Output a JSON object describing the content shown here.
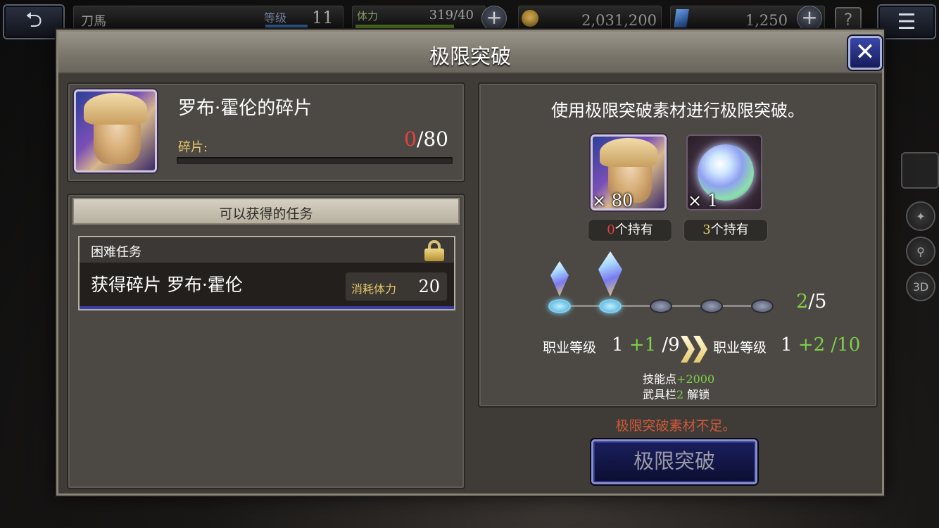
{
  "topbar": {
    "player_name": "刀馬",
    "level_label": "等级",
    "level": "11",
    "stamina_label": "体力",
    "stamina": "319/40",
    "gil": "2,031,200",
    "gems": "1,250",
    "plus": "+",
    "help": "?"
  },
  "side_icons": {
    "icon_3d": "3D"
  },
  "modal": {
    "title": "极限突破",
    "close": "✕"
  },
  "card": {
    "name": "罗布·霍伦的碎片",
    "fragment_label": "碎片:",
    "fragment_owned": "0",
    "fragment_required": "/80"
  },
  "missions": {
    "header": "可以获得的任务",
    "items": [
      {
        "type": "困难任务",
        "name": "获得碎片 罗布·霍伦",
        "stamina_label": "消耗体力",
        "stamina": "20"
      }
    ]
  },
  "limit_break": {
    "description": "使用极限突破素材进行极限突破。",
    "materials": [
      {
        "qty": "× 80",
        "owned_num": "0",
        "owned_label": "个持有"
      },
      {
        "qty": "× 1",
        "owned_num": "3",
        "owned_label": "个持有"
      }
    ],
    "slots_current": "2",
    "slots_total": "/5",
    "job_level_label": "职业等级",
    "job_before": {
      "base": "1",
      "plus": "+1",
      "max": "/9"
    },
    "job_after": {
      "base": "1",
      "plus": "+2",
      "max": "/10"
    },
    "bonus_skill_label": "技能点",
    "bonus_skill_value": "+2000",
    "bonus_weapon_label": "武具栏",
    "bonus_weapon_value": "2",
    "bonus_weapon_suffix": " 解锁"
  },
  "warning": "极限突破素材不足。",
  "break_button": "极限突破",
  "colors": {
    "accent_red": "#e84040",
    "accent_green": "#7fd04a",
    "accent_gold": "#e6c96a",
    "button_blue": "#1a1f5e"
  }
}
